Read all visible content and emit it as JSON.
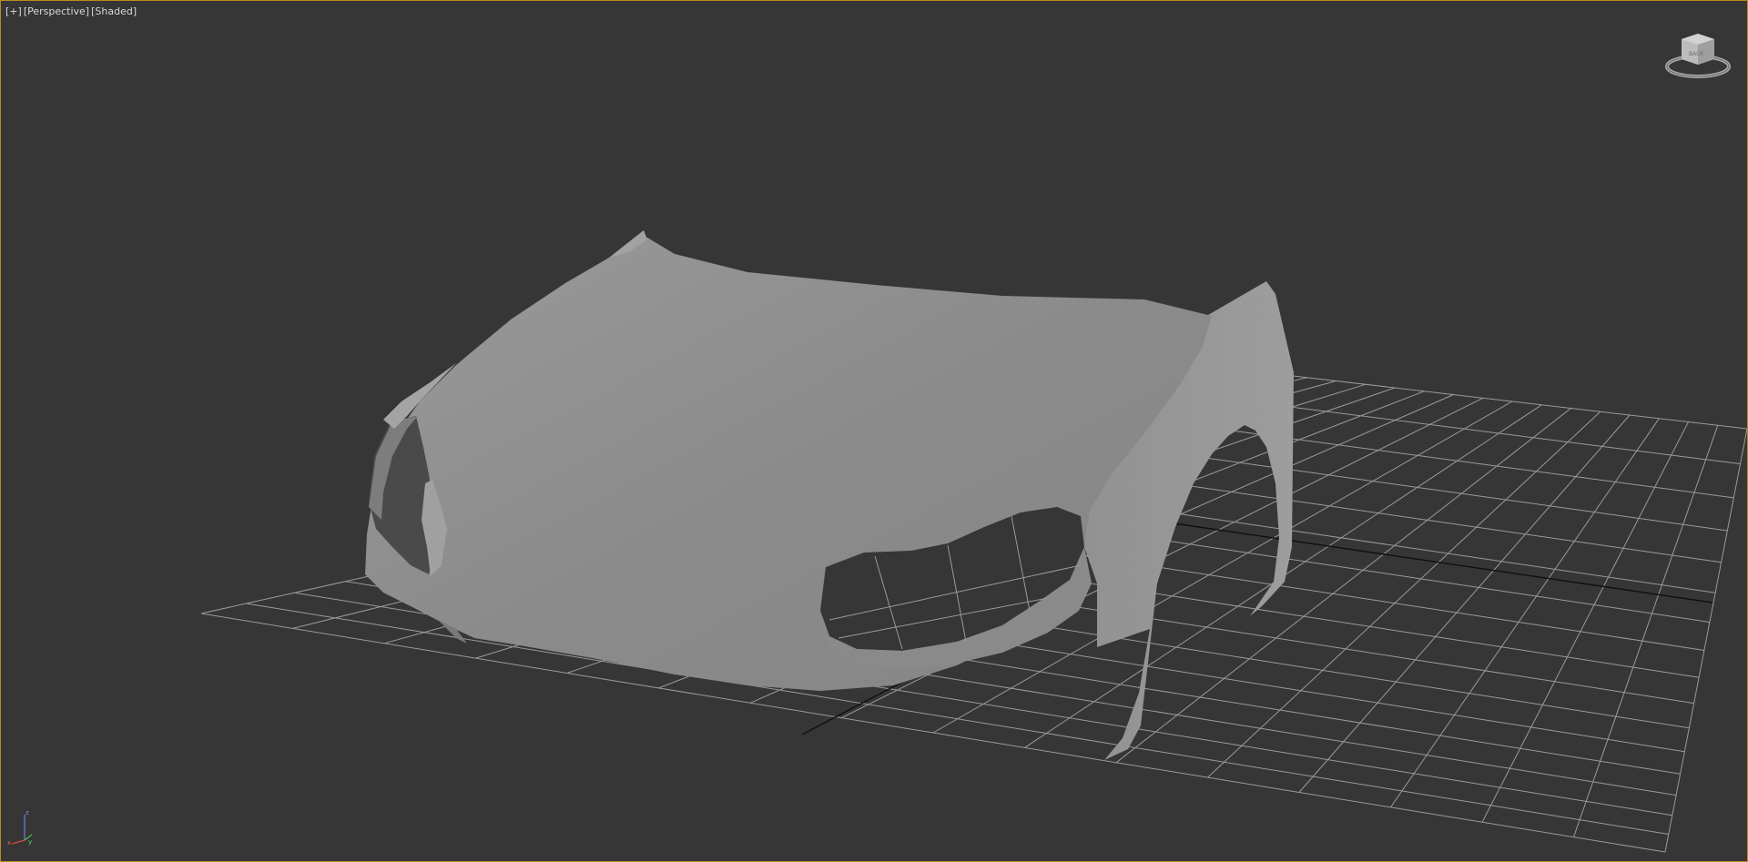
{
  "viewport": {
    "menu_label": "[+]",
    "view_label": "[Perspective]",
    "shading_label": "[Shaded]",
    "active_border_color": "#b98c22",
    "background_color": "#363636"
  },
  "scene": {
    "object": "car front body shell (hood, fenders, bumper)",
    "model_color": "#8c8c8c",
    "grid_color": "#9a9a9a",
    "grid_axis_color": "#111111"
  },
  "viewcube": {
    "face_label": "BACK",
    "icon": "viewcube-icon"
  },
  "axis_tripod": {
    "x_label": "x",
    "y_label": "y",
    "z_label": "z"
  }
}
